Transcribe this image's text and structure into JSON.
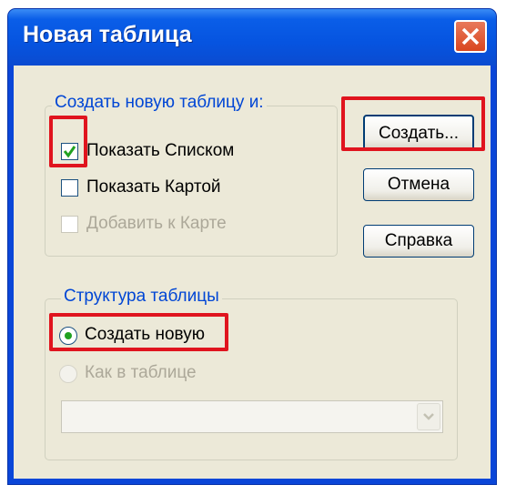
{
  "window": {
    "title": "Новая таблица"
  },
  "create_group": {
    "legend": "Создать новую таблицу и:",
    "show_list": {
      "label": "Показать Списком",
      "checked": true
    },
    "show_map": {
      "label": "Показать Картой",
      "checked": false
    },
    "add_to_map": {
      "label": "Добавить к Карте",
      "checked": false,
      "disabled": true
    }
  },
  "buttons": {
    "create": "Создать...",
    "cancel": "Отмена",
    "help": "Справка"
  },
  "structure_group": {
    "legend": "Структура таблицы",
    "create_new": {
      "label": "Создать новую",
      "selected": true
    },
    "like_table": {
      "label": "Как в таблице",
      "selected": false,
      "disabled": true
    },
    "table_select": {
      "value": ""
    }
  },
  "colors": {
    "highlight": "#e0141e",
    "check": "#21a121",
    "legend": "#0046d5"
  }
}
